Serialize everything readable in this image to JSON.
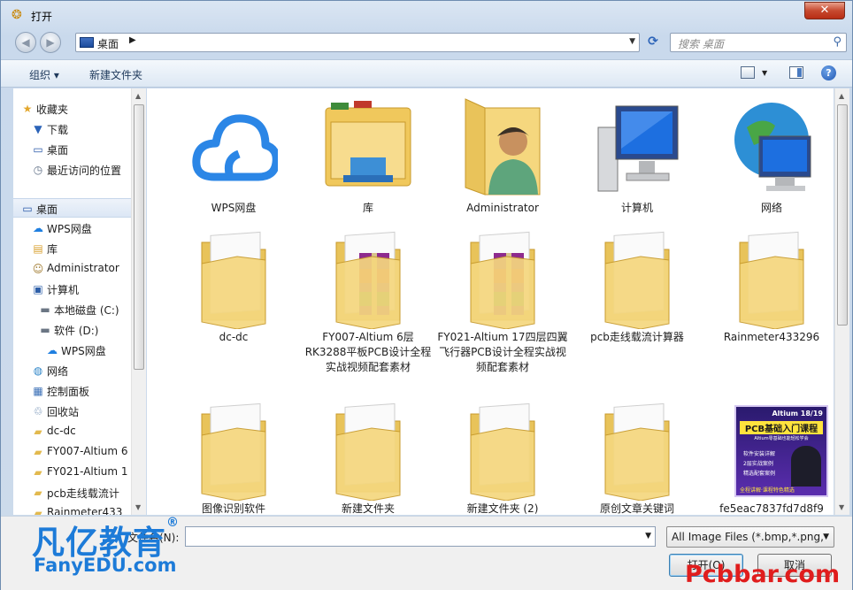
{
  "window": {
    "title": "打开",
    "close_label": "✕"
  },
  "nav": {
    "back": "◀",
    "forward": "▶",
    "location": "桌面",
    "sep": "▶",
    "dropdown": "▼",
    "refresh": "⟳"
  },
  "search": {
    "placeholder": "搜索 桌面"
  },
  "toolbar": {
    "organize": "组织 ▾",
    "new_folder": "新建文件夹",
    "help": "?"
  },
  "sidebar": {
    "items": [
      {
        "label": "收藏夹",
        "icon": "star-icon"
      },
      {
        "label": "下载",
        "icon": "download-folder-icon"
      },
      {
        "label": "桌面",
        "icon": "desktop-icon"
      },
      {
        "label": "最近访问的位置",
        "icon": "recent-places-icon"
      },
      {
        "label": "桌面",
        "icon": "desktop-icon"
      },
      {
        "label": "WPS网盘",
        "icon": "cloud-icon"
      },
      {
        "label": "库",
        "icon": "library-icon"
      },
      {
        "label": "Administrator",
        "icon": "user-folder-icon"
      },
      {
        "label": "计算机",
        "icon": "computer-icon"
      },
      {
        "label": "本地磁盘 (C:)",
        "icon": "drive-icon"
      },
      {
        "label": "软件 (D:)",
        "icon": "drive-icon"
      },
      {
        "label": "WPS网盘",
        "icon": "cloud-icon"
      },
      {
        "label": "网络",
        "icon": "network-icon"
      },
      {
        "label": "控制面板",
        "icon": "control-panel-icon"
      },
      {
        "label": "回收站",
        "icon": "recycle-bin-icon"
      },
      {
        "label": "dc-dc",
        "icon": "folder-icon"
      },
      {
        "label": "FY007-Altium 6",
        "icon": "folder-icon"
      },
      {
        "label": "FY021-Altium 1",
        "icon": "folder-icon"
      },
      {
        "label": "pcb走线载流计",
        "icon": "folder-icon"
      },
      {
        "label": "Rainmeter433",
        "icon": "folder-icon"
      }
    ]
  },
  "files": [
    {
      "caption": "WPS网盘",
      "kind": "cloud"
    },
    {
      "caption": "库",
      "kind": "library"
    },
    {
      "caption": "Administrator",
      "kind": "user"
    },
    {
      "caption": "计算机",
      "kind": "computer"
    },
    {
      "caption": "网络",
      "kind": "network"
    },
    {
      "caption": "dc-dc",
      "kind": "folder"
    },
    {
      "caption": "FY007-Altium 6层 RK3288平板PCB设计全程实战视频配套素材",
      "kind": "rar-folder"
    },
    {
      "caption": "FY021-Altium 17四层四翼飞行器PCB设计全程实战视频配套素材",
      "kind": "rar-folder"
    },
    {
      "caption": "pcb走线载流计算器",
      "kind": "folder"
    },
    {
      "caption": "Rainmeter433296",
      "kind": "folder"
    },
    {
      "caption": "图像识别软件",
      "kind": "folder"
    },
    {
      "caption": "新建文件夹",
      "kind": "folder"
    },
    {
      "caption": "新建文件夹 (2)",
      "kind": "folder"
    },
    {
      "caption": "原创文章关键词",
      "kind": "folder"
    },
    {
      "caption": "fe5eac7837fd7d8f9",
      "kind": "image"
    }
  ],
  "thumb": {
    "brand": "Altium 18/19",
    "title": "PCB基础入门课程",
    "sub": "Altium零基础也能轻松学会",
    "points": [
      "软件安装详解",
      "2层实战案例",
      "精选配套案例"
    ],
    "footer": "全程讲解·课程特色精选"
  },
  "bottom": {
    "filename_label": "文件名(N):",
    "filename_value": "",
    "filter_value": "All Image Files (*.bmp,*.png,",
    "open_label": "打开(O)",
    "cancel_label": "取消"
  },
  "watermark": {
    "brand_cn": "凡亿教育",
    "reg": "®",
    "brand_en": "FanyEDU.com",
    "site": "Pcbbar.com"
  },
  "colors": {
    "accent": "#1d7bd8",
    "watermark_red": "#e01d1d",
    "folder": "#f2cf6e"
  }
}
